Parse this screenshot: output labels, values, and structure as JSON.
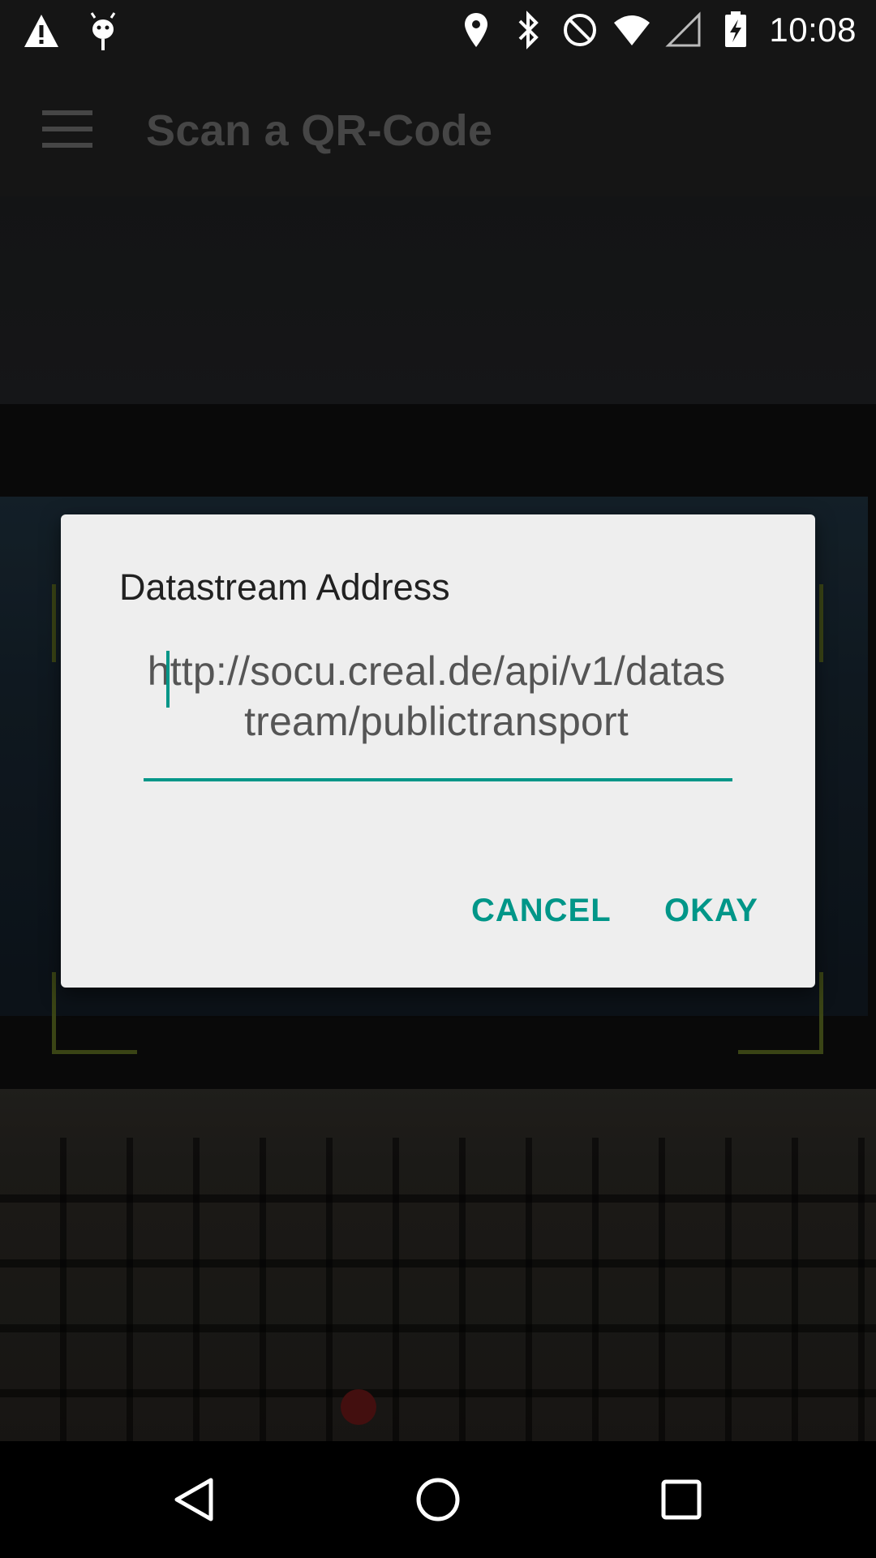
{
  "status_bar": {
    "time": "10:08",
    "icons_left": [
      "warning-icon",
      "android-debug-icon"
    ],
    "icons_right": [
      "location-icon",
      "bluetooth-icon",
      "do-not-disturb-icon",
      "wifi-icon",
      "cellular-icon",
      "battery-charging-icon"
    ]
  },
  "app_bar": {
    "title": "Scan a QR-Code",
    "menu_icon": "hamburger-menu-icon"
  },
  "dialog": {
    "title": "Datastream Address",
    "input_value": "http://socu.creal.de/api/v1/datastream/publictransport",
    "cancel_label": "CANCEL",
    "okay_label": "OKAY",
    "accent_color": "#009688"
  },
  "nav_bar": {
    "icons": [
      "back-icon",
      "home-icon",
      "recents-icon"
    ]
  }
}
